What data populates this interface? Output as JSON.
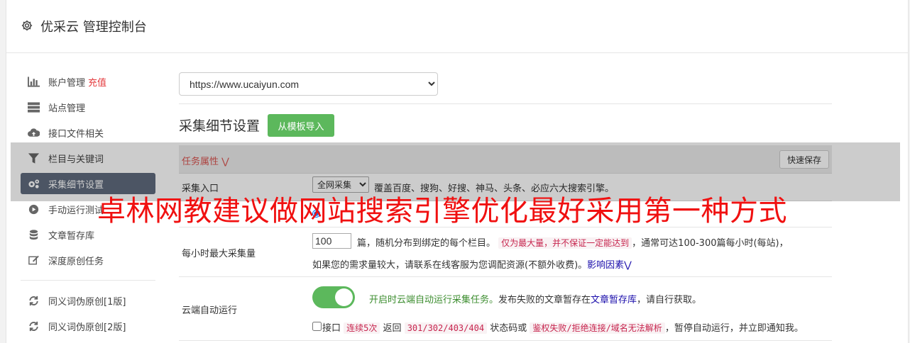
{
  "header": {
    "title": "优采云 管理控制台"
  },
  "sidebar": {
    "items": [
      {
        "label": "账户管理",
        "badge": "充值",
        "icon": "bar-chart-icon"
      },
      {
        "label": "站点管理",
        "icon": "server-icon"
      },
      {
        "label": "接口文件相关",
        "icon": "cloud-upload-icon"
      },
      {
        "label": "栏目与关键词",
        "icon": "filter-icon"
      },
      {
        "label": "采集细节设置",
        "icon": "cogs-icon"
      },
      {
        "label": "手动运行测试",
        "icon": "play-circle-icon"
      },
      {
        "label": "文章暂存库",
        "icon": "database-icon"
      },
      {
        "label": "深度原创任务",
        "icon": "edit-icon"
      },
      {
        "label": "同义词伪原创[1版]",
        "icon": "refresh-icon"
      },
      {
        "label": "同义词伪原创[2版]",
        "icon": "refresh-icon"
      }
    ]
  },
  "main": {
    "site_select": "https://www.ucaiyun.com",
    "section_title": "采集细节设置",
    "import_button": "从模板导入",
    "task_header": {
      "label": "任务属性",
      "quick_save": "快速保存"
    },
    "collect_entry": {
      "label": "采集入口",
      "select_value": "全网采集",
      "desc": "覆盖百度、搜狗、好搜、神马、头条、必应六大搜索引擎。"
    },
    "max_per_hour": {
      "label": "每小时最大采集量",
      "value": "100",
      "text1": "篇，随机分布到绑定的每个栏目。",
      "highlight": "仅为最大量，并不保证一定能达到",
      "text2": "，通常可达100-300篇每小时(每站)，",
      "text3": "如果您的需求量较大，请联系在线客服为您调配资源(不额外收费)。",
      "link": "影响因素"
    },
    "cloud_run": {
      "label": "云端自动运行",
      "desc_green": "开启时云端自动运行采集任务。",
      "desc1": "发布失败的文章暂存在",
      "desc_link": "文章暂存库",
      "desc2": "，请自行获取。",
      "chk_text1": "接口",
      "chk_code1": "连续5次",
      "chk_text2": "返回",
      "chk_code2": "301/302/403/404",
      "chk_text3": "状态码或",
      "chk_code3": "鉴权失败/拒绝连接/域名无法解析",
      "chk_text4": "，暂停自动运行，并立即通知我。"
    }
  },
  "watermark": "卓林网教建议做网站搜索引擎优化最好采用第一种方式",
  "colors": {
    "accent_green": "#5cb85c",
    "active_nav": "#5f6b7d",
    "alert_red": "#d9534f",
    "watermark_red": "#f01010"
  }
}
